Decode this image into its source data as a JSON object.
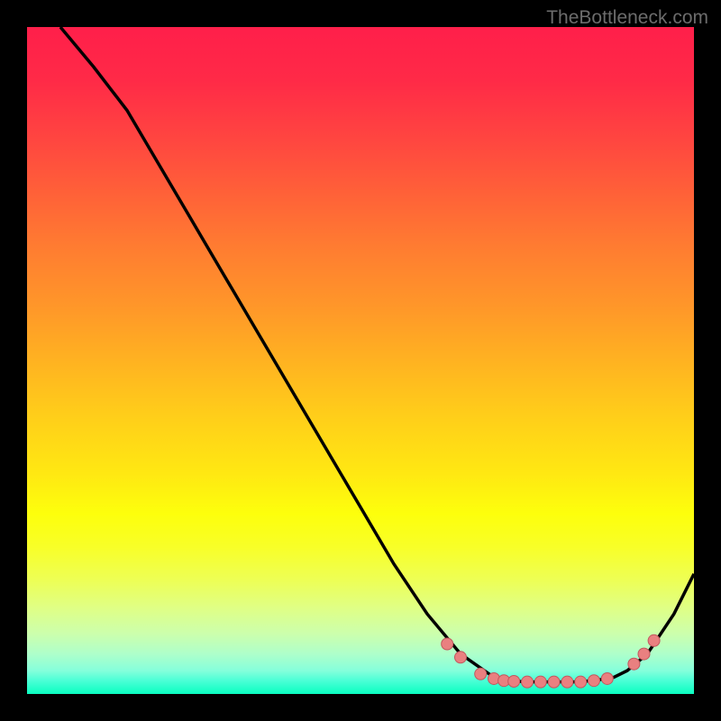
{
  "attribution": "TheBottleneck.com",
  "chart_data": {
    "type": "line",
    "title": "",
    "xlabel": "",
    "ylabel": "",
    "xlim": [
      0,
      100
    ],
    "ylim": [
      0,
      100
    ],
    "series": [
      {
        "name": "curve",
        "x": [
          5,
          10,
          15,
          20,
          25,
          30,
          35,
          40,
          45,
          50,
          55,
          60,
          65,
          70,
          72,
          75,
          78,
          80,
          82,
          85,
          88,
          90,
          93,
          97,
          100
        ],
        "y": [
          100,
          94,
          87.5,
          79,
          70.5,
          62,
          53.5,
          45,
          36.5,
          28,
          19.5,
          12,
          6,
          2.5,
          2,
          1.8,
          1.8,
          1.8,
          1.8,
          2,
          2.5,
          3.5,
          6,
          12,
          18
        ]
      }
    ],
    "dots": {
      "name": "highlight-points",
      "points": [
        {
          "x": 63,
          "y": 7.5
        },
        {
          "x": 65,
          "y": 5.5
        },
        {
          "x": 68,
          "y": 3
        },
        {
          "x": 70,
          "y": 2.3
        },
        {
          "x": 71.5,
          "y": 2
        },
        {
          "x": 73,
          "y": 1.9
        },
        {
          "x": 75,
          "y": 1.8
        },
        {
          "x": 77,
          "y": 1.8
        },
        {
          "x": 79,
          "y": 1.8
        },
        {
          "x": 81,
          "y": 1.8
        },
        {
          "x": 83,
          "y": 1.8
        },
        {
          "x": 85,
          "y": 2
        },
        {
          "x": 87,
          "y": 2.3
        },
        {
          "x": 91,
          "y": 4.5
        },
        {
          "x": 92.5,
          "y": 6
        },
        {
          "x": 94,
          "y": 8
        }
      ]
    }
  }
}
